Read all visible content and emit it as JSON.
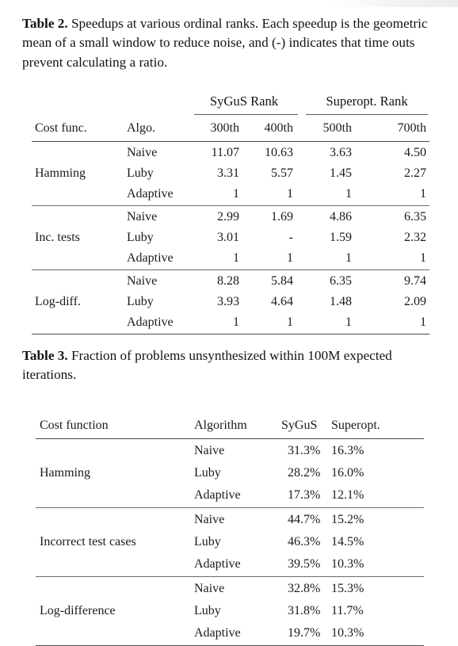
{
  "table2": {
    "caption_lead": "Table 2.",
    "caption_text": " Speedups at various ordinal ranks. Each speedup is the geometric mean of a small window to reduce noise, and (-) indicates that time outs prevent calculating a ratio.",
    "group_headers": [
      {
        "label": "SyGuS Rank",
        "spans": [
          "300th",
          "400th"
        ]
      },
      {
        "label": "Superopt. Rank",
        "spans": [
          "500th",
          "700th"
        ]
      }
    ],
    "columns": [
      "Cost func.",
      "Algo.",
      "300th",
      "400th",
      "500th",
      "700th"
    ],
    "groups": [
      {
        "cost_function": "Hamming",
        "rows": [
          {
            "algorithm": "Naive",
            "r300": "11.07",
            "r400": "10.63",
            "r500": "3.63",
            "r700": "4.50"
          },
          {
            "algorithm": "Luby",
            "r300": "3.31",
            "r400": "5.57",
            "r500": "1.45",
            "r700": "2.27"
          },
          {
            "algorithm": "Adaptive",
            "r300": "1",
            "r400": "1",
            "r500": "1",
            "r700": "1"
          }
        ]
      },
      {
        "cost_function": "Inc. tests",
        "rows": [
          {
            "algorithm": "Naive",
            "r300": "2.99",
            "r400": "1.69",
            "r500": "4.86",
            "r700": "6.35"
          },
          {
            "algorithm": "Luby",
            "r300": "3.01",
            "r400": "-",
            "r500": "1.59",
            "r700": "2.32"
          },
          {
            "algorithm": "Adaptive",
            "r300": "1",
            "r400": "1",
            "r500": "1",
            "r700": "1"
          }
        ]
      },
      {
        "cost_function": "Log-diff.",
        "rows": [
          {
            "algorithm": "Naive",
            "r300": "8.28",
            "r400": "5.84",
            "r500": "6.35",
            "r700": "9.74"
          },
          {
            "algorithm": "Luby",
            "r300": "3.93",
            "r400": "4.64",
            "r500": "1.48",
            "r700": "2.09"
          },
          {
            "algorithm": "Adaptive",
            "r300": "1",
            "r400": "1",
            "r500": "1",
            "r700": "1"
          }
        ]
      }
    ]
  },
  "table3": {
    "caption_lead": "Table 3.",
    "caption_text": " Fraction of problems unsynthesized within 100M expected iterations.",
    "columns": [
      "Cost function",
      "Algorithm",
      "SyGuS",
      "Superopt."
    ],
    "groups": [
      {
        "cost_function": "Hamming",
        "rows": [
          {
            "algorithm": "Naive",
            "sygus": "31.3%",
            "superopt": "16.3%"
          },
          {
            "algorithm": "Luby",
            "sygus": "28.2%",
            "superopt": "16.0%"
          },
          {
            "algorithm": "Adaptive",
            "sygus": "17.3%",
            "superopt": "12.1%"
          }
        ]
      },
      {
        "cost_function": "Incorrect test cases",
        "rows": [
          {
            "algorithm": "Naive",
            "sygus": "44.7%",
            "superopt": "15.2%"
          },
          {
            "algorithm": "Luby",
            "sygus": "46.3%",
            "superopt": "14.5%"
          },
          {
            "algorithm": "Adaptive",
            "sygus": "39.5%",
            "superopt": "10.3%"
          }
        ]
      },
      {
        "cost_function": "Log-difference",
        "rows": [
          {
            "algorithm": "Naive",
            "sygus": "32.8%",
            "superopt": "15.3%"
          },
          {
            "algorithm": "Luby",
            "sygus": "31.8%",
            "superopt": "11.7%"
          },
          {
            "algorithm": "Adaptive",
            "sygus": "19.7%",
            "superopt": "10.3%"
          }
        ]
      }
    ]
  },
  "colors": {
    "page_background": "#ffffff",
    "text": "#151515",
    "rule": "#4a4a4a"
  }
}
